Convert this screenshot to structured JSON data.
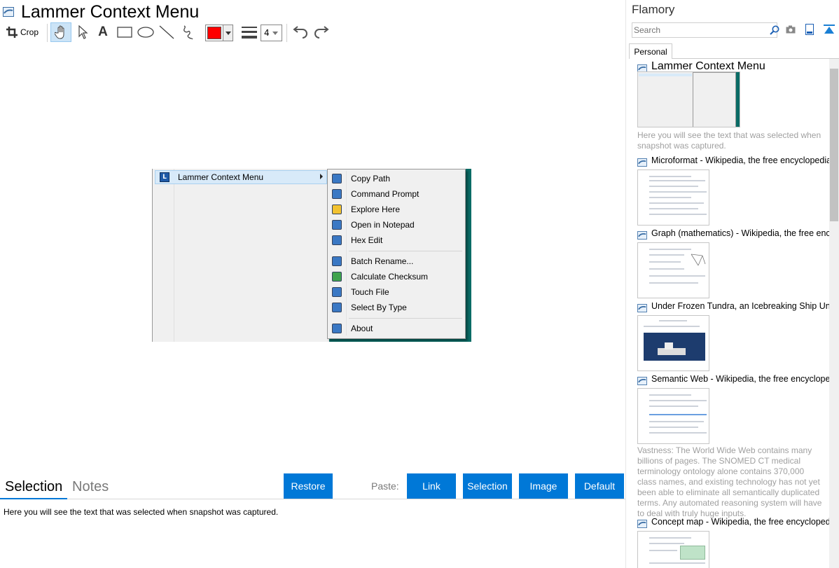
{
  "window": {
    "title": "Lammer Context Menu"
  },
  "toolbar": {
    "crop_label": "Crop",
    "pen_width": "4",
    "pen_color": "#ff0000"
  },
  "snapshot": {
    "submenu_label": "Lammer Context Menu",
    "items": [
      {
        "label": "Copy Path",
        "icon": "copy-path-icon"
      },
      {
        "label": "Command Prompt",
        "icon": "command-prompt-icon"
      },
      {
        "label": "Explore Here",
        "icon": "folder-icon"
      },
      {
        "label": "Open in Notepad",
        "icon": "notepad-icon"
      },
      {
        "label": "Hex Edit",
        "icon": "hex-edit-icon"
      },
      {
        "label": "Batch Rename...",
        "icon": "batch-rename-icon"
      },
      {
        "label": "Calculate Checksum",
        "icon": "checksum-icon"
      },
      {
        "label": "Touch File",
        "icon": "touch-file-icon"
      },
      {
        "label": "Select By Type",
        "icon": "select-by-type-icon"
      },
      {
        "label": "About",
        "icon": "about-icon"
      }
    ]
  },
  "bottom": {
    "tabs": [
      {
        "label": "Selection"
      },
      {
        "label": "Notes"
      }
    ],
    "restore_label": "Restore",
    "paste_label": "Paste:",
    "paste_buttons": [
      {
        "label": "Link"
      },
      {
        "label": "Selection"
      },
      {
        "label": "Image"
      },
      {
        "label": "Default"
      }
    ],
    "selection_text": "Here you will see the text that was selected when snapshot was captured."
  },
  "sidebar": {
    "title": "Flamory",
    "search_placeholder": "Search",
    "tab": "Personal",
    "entries": [
      {
        "title": "Lammer Context Menu",
        "description": "Here you will see the text that was selected when snapshot was captured."
      },
      {
        "title": "Microformat - Wikipedia, the free encyclopedia",
        "description": ""
      },
      {
        "title": "Graph (mathematics) - Wikipedia, the free encyclopedia",
        "description": ""
      },
      {
        "title": "Under Frozen Tundra, an Icebreaking Ship Uncovers...",
        "description": ""
      },
      {
        "title": "Semantic Web - Wikipedia, the free encyclopedia",
        "description": "Vastness: The World Wide Web contains many billions of pages. The SNOMED CT medical terminology ontology alone contains 370,000 class names, and existing technology has not yet been able to eliminate all semantically duplicated terms. Any automated reasoning system will have to deal with truly huge inputs."
      },
      {
        "title": "Concept map - Wikipedia, the free encyclopedia",
        "description": ""
      }
    ]
  },
  "colors": {
    "accent": "#0078d7",
    "snapshot_background": "#0a6c66"
  }
}
